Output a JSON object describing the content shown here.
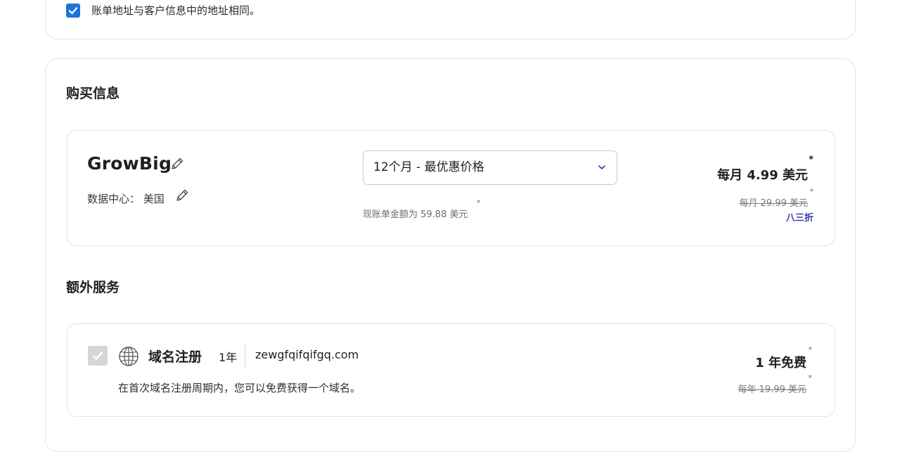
{
  "billing": {
    "same_address_label": "账单地址与客户信息中的地址相同。",
    "checked": true
  },
  "purchase": {
    "title": "购买信息",
    "plan": {
      "name": "GrowBig",
      "datacenter_label": "数据中心：",
      "datacenter_value": "美国",
      "period_selected": "12个月 - 最优惠价格",
      "bill_note": "现账单金额为 59.88 美元",
      "price": "每月 4.99 美元",
      "old_price": "每月 29.99 美元",
      "discount": "八三折",
      "asterisk": "*"
    }
  },
  "extras": {
    "title": "额外服务",
    "domain": {
      "title": "域名注册",
      "term": "1年",
      "name": "zewgfqifqifgq.com",
      "description": "在首次域名注册周期内，您可以免费获得一个域名。",
      "price": "1 年免费",
      "old_price": "每年 19.99 美元",
      "asterisk": "*"
    }
  },
  "colors": {
    "checkbox": "#1b74d9",
    "discount": "#3b35b3",
    "border": "#e3e3e6"
  },
  "icons": {
    "check": "check-icon",
    "edit": "pencil-icon",
    "dropdown": "chevron-down-icon",
    "domain": "globe-icon"
  }
}
